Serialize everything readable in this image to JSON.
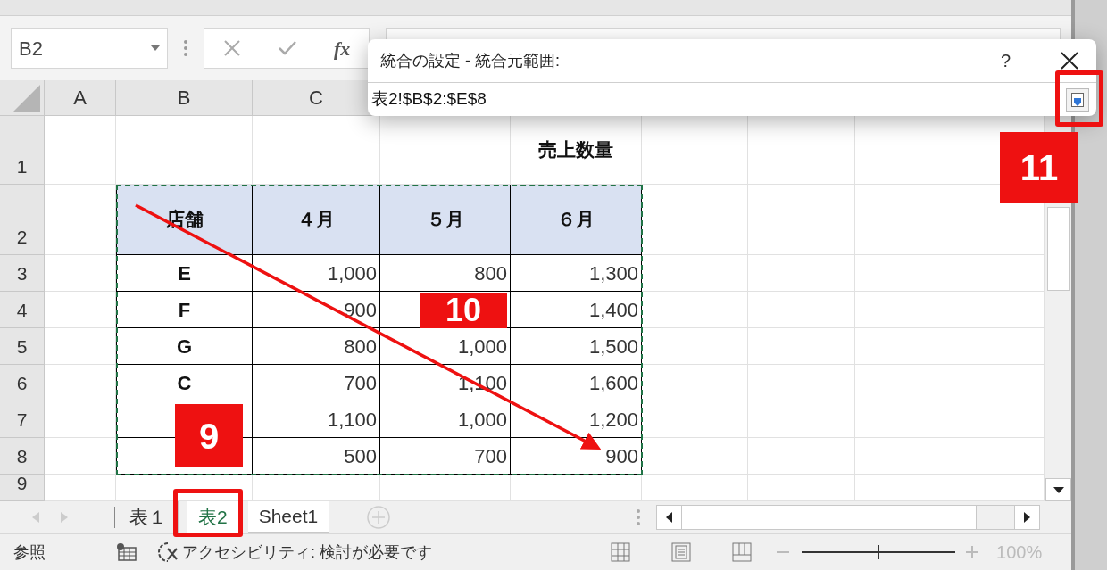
{
  "name_box": {
    "value": "B2"
  },
  "formula_bar": {
    "function_label": "fx"
  },
  "dialog": {
    "title": "統合の設定 - 統合元範囲:",
    "help": "?",
    "reference": "表2!$B$2:$E$8"
  },
  "column_headers": [
    "A",
    "B",
    "C"
  ],
  "row_headers": [
    "1",
    "2",
    "3",
    "4",
    "5",
    "6",
    "7",
    "8",
    "9"
  ],
  "title_cell": "売上数量",
  "table": {
    "columns": [
      "店舗",
      "４月",
      "５月",
      "６月"
    ],
    "rows": [
      {
        "store": "E",
        "values": [
          "1,000",
          "800",
          "1,300"
        ]
      },
      {
        "store": "F",
        "values": [
          "900",
          {
            "covered": true
          },
          "1,400"
        ]
      },
      {
        "store": "G",
        "values": [
          "800",
          "1,000",
          "1,500"
        ]
      },
      {
        "store": "C",
        "values": [
          "700",
          "1,100",
          "1,600"
        ]
      },
      {
        "values": [
          "1,100",
          "1,000",
          "1,200"
        ]
      },
      {
        "values": [
          "500",
          "700",
          "900"
        ]
      }
    ]
  },
  "sheet_tabs": [
    {
      "label": "表１",
      "selected": false,
      "underlined": false
    },
    {
      "label": "表2",
      "selected": true,
      "underlined": false
    },
    {
      "label": "Sheet1",
      "selected": false,
      "underlined": true
    }
  ],
  "status_bar": {
    "mode": "参照",
    "accessibility": "アクセシビリティ: 検討が必要です",
    "zoom": "100%",
    "zoom_slider": {
      "level": 0.5
    }
  },
  "annotations": [
    {
      "label": "9"
    },
    {
      "label": "10"
    },
    {
      "label": "11"
    }
  ]
}
